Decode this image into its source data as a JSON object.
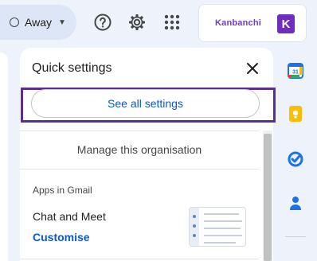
{
  "header": {
    "status": {
      "label": "Away",
      "dropdown_icon": "chevron-down-icon"
    },
    "icons": [
      "help-icon",
      "gear-icon",
      "apps-grid-icon"
    ],
    "addon": {
      "name": "Kanbanchi",
      "badge_letter": "K",
      "brand_color": "#6f2dbd"
    }
  },
  "quick_settings": {
    "title": "Quick settings",
    "close_icon": "close-icon",
    "see_all_button": "See all settings",
    "manage_link": "Manage this organisation",
    "apps_section": {
      "heading": "Apps in Gmail",
      "item_label": "Chat and Meet",
      "customise_link": "Customise"
    }
  },
  "side_panel": {
    "icons": [
      "calendar-icon",
      "keep-icon",
      "tasks-icon",
      "contacts-icon"
    ],
    "calendar_day": "31"
  },
  "colors": {
    "accent_blue": "#0b57d0",
    "highlight_purple": "#5c2e91",
    "background": "#eef3fb"
  }
}
